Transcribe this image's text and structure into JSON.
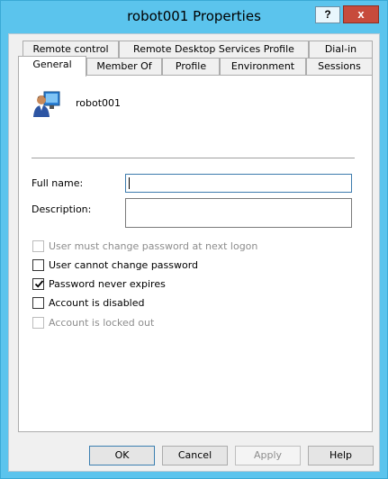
{
  "window": {
    "title": "robot001 Properties",
    "help_glyph": "?",
    "close_glyph": "x"
  },
  "tabs_row1": [
    {
      "label": "Remote control"
    },
    {
      "label": "Remote Desktop Services Profile"
    },
    {
      "label": "Dial-in"
    }
  ],
  "tabs_row2": [
    {
      "label": "General",
      "selected": true
    },
    {
      "label": "Member Of"
    },
    {
      "label": "Profile"
    },
    {
      "label": "Environment"
    },
    {
      "label": "Sessions"
    }
  ],
  "general": {
    "icon": "user-icon",
    "username": "robot001",
    "full_name_label": "Full name:",
    "full_name_value": "",
    "description_label": "Description:",
    "description_value": ""
  },
  "options": [
    {
      "label": "User must change password at next logon",
      "checked": false,
      "enabled": false
    },
    {
      "label": "User cannot change password",
      "checked": false,
      "enabled": true
    },
    {
      "label": "Password never expires",
      "checked": true,
      "enabled": true
    },
    {
      "label": "Account is disabled",
      "checked": false,
      "enabled": true
    },
    {
      "label": "Account is locked out",
      "checked": false,
      "enabled": false
    }
  ],
  "buttons": {
    "ok": "OK",
    "cancel": "Cancel",
    "apply": "Apply",
    "help": "Help"
  }
}
